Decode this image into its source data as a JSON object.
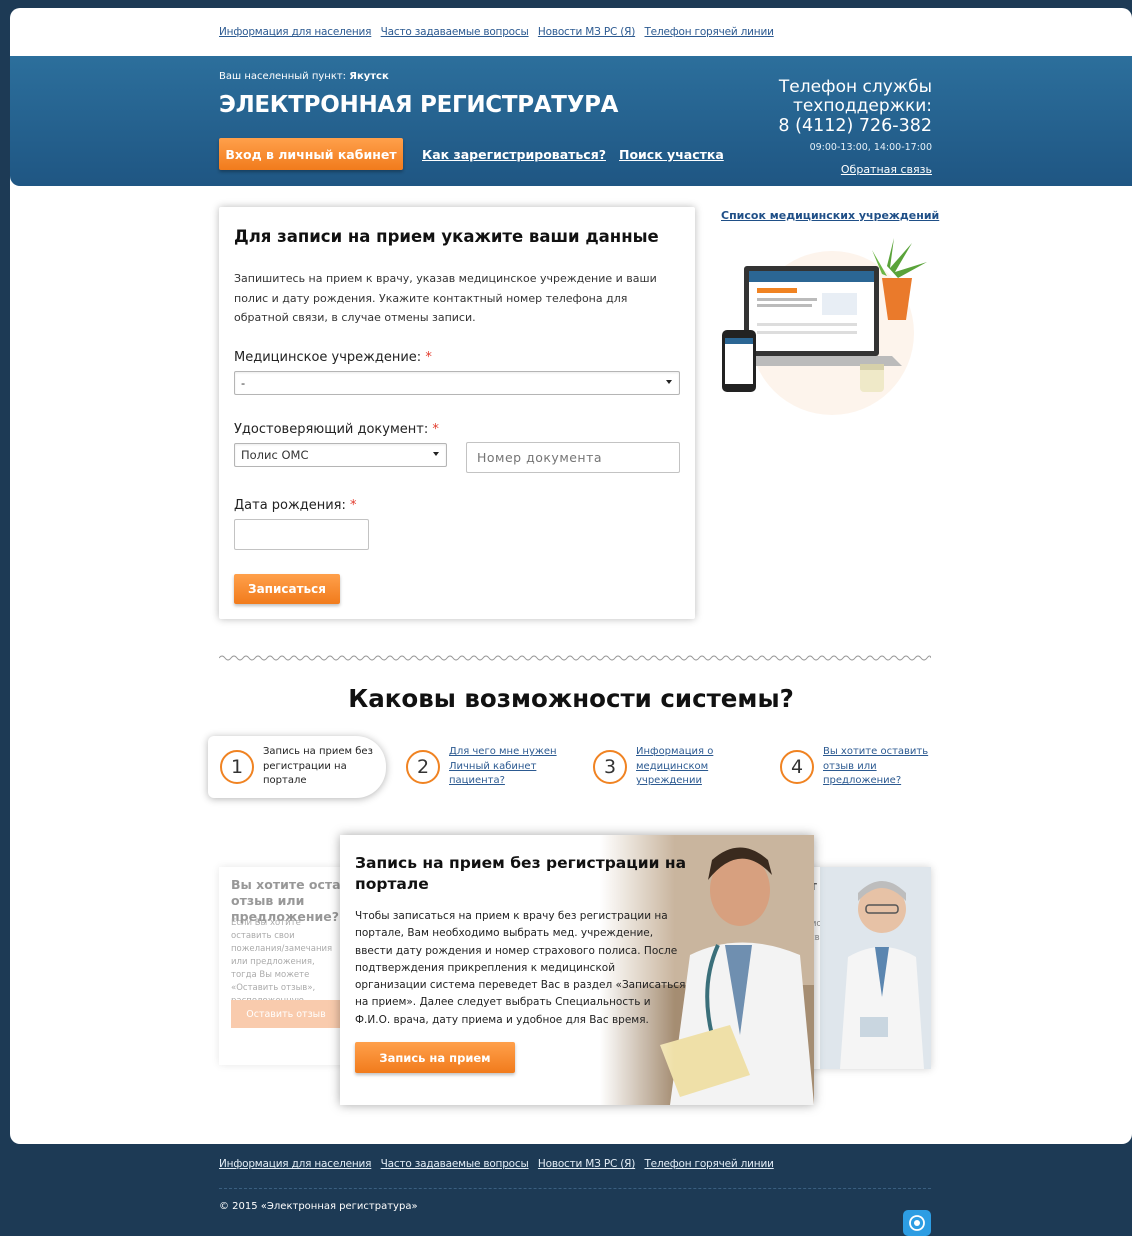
{
  "top_nav": {
    "links": [
      "Информация для населения",
      "Часто задаваемые вопросы",
      "Новости МЗ РС (Я)",
      "Телефон горячей линии"
    ]
  },
  "header": {
    "locality_label": "Ваш населенный пункт:",
    "locality_value": "Якутск",
    "brand": "ЭЛЕКТРОННАЯ РЕГИСТРАТУРА",
    "login_button": "Вход в личный кабинет",
    "how_register": "Как зарегистрироваться?",
    "find_district": "Поиск участка",
    "support_title_1": "Телефон службы",
    "support_title_2": "техподдержки:",
    "support_phone": "8 (4112) 726-382",
    "support_hours": "09:00-13:00, 14:00-17:00",
    "feedback": "Обратная связь"
  },
  "form": {
    "title": "Для записи на прием укажите ваши данные",
    "description": "Запишитесь на прием к врачу, указав медицинское учреждение и ваши полис и дату рождения. Укажите контактный номер телефона для обратной связи, в случае отмены записи.",
    "institution_label": "Медицинское учреждение:",
    "institution_value": "-",
    "document_label": "Удостоверяющий документ:",
    "document_value": "Полис ОМС",
    "document_number_placeholder": "Номер документа",
    "birthdate_label": "Дата рождения:",
    "required_mark": "*",
    "submit": "Записаться"
  },
  "sidebar": {
    "med_list_link": "Список медицинских учреждений"
  },
  "features": {
    "title": "Каковы возможности системы?",
    "steps": [
      {
        "num": "1",
        "text": "Запись на прием без регистрации на портале"
      },
      {
        "num": "2",
        "text": "Для чего мне нужен Личный кабинет пациента?"
      },
      {
        "num": "3",
        "text": "Информация о медицинском учреждении"
      },
      {
        "num": "4",
        "text": "Вы хотите оставить отзыв или предложение?"
      }
    ],
    "main_card": {
      "title": "Запись на прием без регистрации на портале",
      "text": "Чтобы записаться на прием к врачу без регистрации на портале, Вам необходимо выбрать мед. учреждение, ввести дату рождения и номер страхового полиса. После подтверждения прикрепления к медицинской организации система переведет Вас в раздел «Записаться на прием». Далее следует выбрать Специальность и Ф.И.О. врача, дату приема и удобное для Вас время.",
      "button": "Запись на прием"
    },
    "left_card": {
      "title": "Вы хотите оставить отзыв или предложение?",
      "text": "Если Вы хотите оставить свои пожелания/замечания или предложения, тогда Вы можете «Оставить отзыв», расположенную",
      "button": "Оставить отзыв"
    },
    "right_card": {
      "title": "т",
      "text": "могут не свои"
    }
  },
  "footer": {
    "links": [
      "Информация для населения",
      "Часто задаваемые вопросы",
      "Новости МЗ РС (Я)",
      "Телефон горячей линии"
    ],
    "copyright": "© 2015 «Электронная регистратура»"
  },
  "colors": {
    "header_bg": "#2c6f9c",
    "footer_bg": "#1d3a55",
    "accent": "#f17b1c",
    "link": "#2c5a91",
    "required": "#e23b2c"
  }
}
